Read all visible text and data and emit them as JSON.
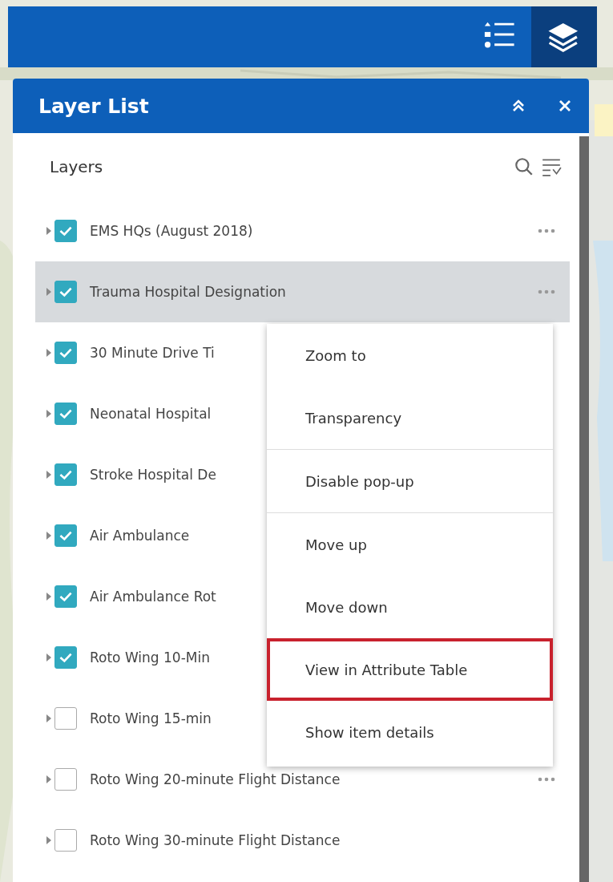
{
  "toolbar": {
    "buttons": [
      {
        "kind": "legend",
        "selected": false
      },
      {
        "kind": "layers",
        "selected": true
      }
    ]
  },
  "panel": {
    "title": "Layer List",
    "section_title": "Layers",
    "layers": [
      {
        "label": "EMS HQs (August 2018)",
        "checked": true,
        "selected": false,
        "options": true
      },
      {
        "label": "Trauma Hospital Designation",
        "checked": true,
        "selected": true,
        "options": true
      },
      {
        "label": "30 Minute Drive Ti",
        "checked": true,
        "selected": false,
        "options": false
      },
      {
        "label": "Neonatal Hospital",
        "checked": true,
        "selected": false,
        "options": false
      },
      {
        "label": "Stroke Hospital De",
        "checked": true,
        "selected": false,
        "options": false
      },
      {
        "label": "Air Ambulance",
        "checked": true,
        "selected": false,
        "options": false
      },
      {
        "label": "Air Ambulance Rot",
        "checked": true,
        "selected": false,
        "options": false
      },
      {
        "label": "Roto Wing 10-Min",
        "checked": true,
        "selected": false,
        "options": false
      },
      {
        "label": "Roto Wing 15-min",
        "checked": false,
        "selected": false,
        "options": false
      },
      {
        "label": "Roto Wing 20-minute Flight Distance",
        "checked": false,
        "selected": false,
        "options": true
      },
      {
        "label": "Roto Wing 30-minute Flight Distance",
        "checked": false,
        "selected": false,
        "options": false
      }
    ],
    "menu": {
      "groups": [
        [
          {
            "label": "Zoom to",
            "outlined": false
          },
          {
            "label": "Transparency",
            "outlined": false
          }
        ],
        [
          {
            "label": "Disable pop-up",
            "outlined": false
          }
        ],
        [
          {
            "label": "Move up",
            "outlined": false
          },
          {
            "label": "Move down",
            "outlined": false
          },
          {
            "label": "View in Attribute Table",
            "outlined": true
          },
          {
            "label": "Show item details",
            "outlined": false
          }
        ]
      ]
    }
  }
}
